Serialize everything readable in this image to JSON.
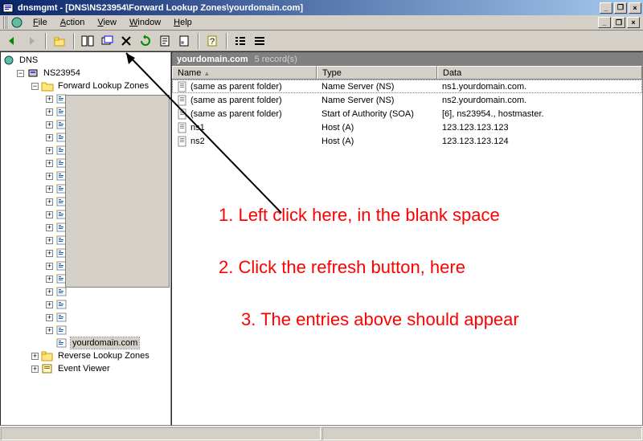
{
  "titlebar": {
    "app_name": "dnsmgmt",
    "path": "[DNS\\NS23954\\Forward Lookup Zones\\yourdomain.com]",
    "full_title": "dnsmgmt - [DNS\\NS23954\\Forward Lookup Zones\\yourdomain.com]"
  },
  "menu": {
    "file": "File",
    "action": "Action",
    "view": "View",
    "window": "Window",
    "help": "Help"
  },
  "tree": {
    "root": "DNS",
    "server": "NS23954",
    "forward_zones": "Forward Lookup Zones",
    "reverse_zones": "Reverse Lookup Zones",
    "event_viewer": "Event Viewer",
    "selected_zone": "yourdomain.com",
    "hidden_zone_count": 19
  },
  "list": {
    "title": "yourdomain.com",
    "record_count": "5 record(s)",
    "columns": {
      "name": "Name",
      "type": "Type",
      "data": "Data"
    },
    "records": [
      {
        "name": "(same as parent folder)",
        "type": "Name Server (NS)",
        "data": "ns1.yourdomain.com."
      },
      {
        "name": "(same as parent folder)",
        "type": "Name Server (NS)",
        "data": "ns2.yourdomain.com."
      },
      {
        "name": "(same as parent folder)",
        "type": "Start of Authority (SOA)",
        "data": "[6], ns23954., hostmaster."
      },
      {
        "name": "ns1",
        "type": "Host (A)",
        "data": "123.123.123.123"
      },
      {
        "name": "ns2",
        "type": "Host (A)",
        "data": "123.123.123.124"
      }
    ]
  },
  "annotations": {
    "step1": "1. Left click here, in the blank space",
    "step2": "2. Click the refresh button, here",
    "step3": "3. The entries above should appear"
  },
  "colors": {
    "annotation": "#ff0000",
    "titlebar_gradient_start": "#0a246a",
    "titlebar_gradient_end": "#a6caf0",
    "chrome": "#d4d0c8"
  }
}
